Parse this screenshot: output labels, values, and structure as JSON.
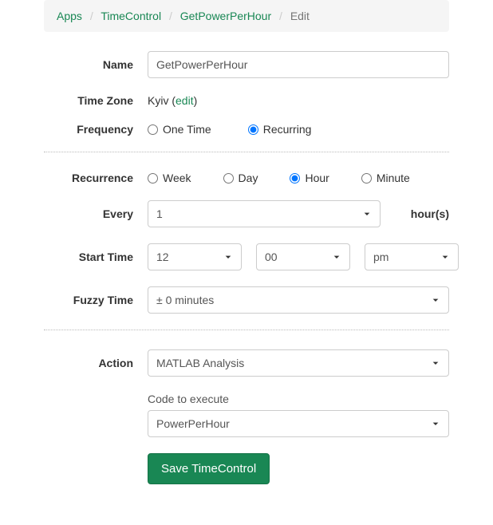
{
  "breadcrumb": {
    "items": [
      {
        "label": "Apps"
      },
      {
        "label": "TimeControl"
      },
      {
        "label": "GetPowerPerHour"
      }
    ],
    "active": "Edit",
    "separator": "/"
  },
  "form": {
    "name": {
      "label": "Name",
      "value": "GetPowerPerHour"
    },
    "timezone": {
      "label": "Time Zone",
      "value": "Kyiv",
      "edit_prefix": "(",
      "edit_text": "edit",
      "edit_suffix": ")"
    },
    "frequency": {
      "label": "Frequency",
      "options": [
        {
          "label": "One Time",
          "checked": false
        },
        {
          "label": "Recurring",
          "checked": true
        }
      ]
    },
    "recurrence": {
      "label": "Recurrence",
      "options": [
        {
          "label": "Week",
          "checked": false
        },
        {
          "label": "Day",
          "checked": false
        },
        {
          "label": "Hour",
          "checked": true
        },
        {
          "label": "Minute",
          "checked": false
        }
      ]
    },
    "every": {
      "label": "Every",
      "value": "1",
      "suffix": "hour(s)"
    },
    "start_time": {
      "label": "Start Time",
      "hour": "12",
      "minute": "00",
      "ampm": "pm"
    },
    "fuzzy": {
      "label": "Fuzzy Time",
      "value": "± 0 minutes"
    },
    "action": {
      "label": "Action",
      "value": "MATLAB Analysis"
    },
    "code": {
      "label": "Code to execute",
      "value": "PowerPerHour"
    },
    "save": {
      "label": "Save TimeControl"
    }
  }
}
